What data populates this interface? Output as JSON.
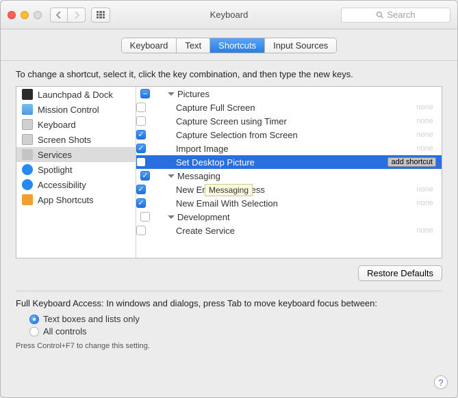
{
  "window": {
    "title": "Keyboard",
    "search_placeholder": "Search"
  },
  "tabs": [
    "Keyboard",
    "Text",
    "Shortcuts",
    "Input Sources"
  ],
  "active_tab": 2,
  "instruction": "To change a shortcut, select it, click the key combination, and then type the new keys.",
  "sidebar": {
    "items": [
      {
        "label": "Launchpad & Dock",
        "icon": "launchpad"
      },
      {
        "label": "Mission Control",
        "icon": "mission"
      },
      {
        "label": "Keyboard",
        "icon": "keyboard"
      },
      {
        "label": "Screen Shots",
        "icon": "screenshots"
      },
      {
        "label": "Services",
        "icon": "services"
      },
      {
        "label": "Spotlight",
        "icon": "spotlight"
      },
      {
        "label": "Accessibility",
        "icon": "access"
      },
      {
        "label": "App Shortcuts",
        "icon": "appshort"
      }
    ],
    "selected": 4
  },
  "shortcuts": {
    "none_label": "none",
    "add_shortcut_label": "add shortcut",
    "groups": [
      {
        "name": "Pictures",
        "state": "mixed",
        "items": [
          {
            "label": "Capture Full Screen",
            "checked": false,
            "shortcut": "none"
          },
          {
            "label": "Capture Screen using Timer",
            "checked": false,
            "shortcut": "none"
          },
          {
            "label": "Capture Selection from Screen",
            "checked": true,
            "shortcut": "none"
          },
          {
            "label": "Import Image",
            "checked": true,
            "shortcut": "none"
          },
          {
            "label": "Set Desktop Picture",
            "checked": false,
            "shortcut": "add",
            "selected": true
          }
        ]
      },
      {
        "name": "Messaging",
        "state": "checked",
        "items": [
          {
            "label": "New Email To Address",
            "checked": true,
            "shortcut": "none",
            "tooltip": "Messaging"
          },
          {
            "label": "New Email With Selection",
            "checked": true,
            "shortcut": "none"
          }
        ]
      },
      {
        "name": "Development",
        "state": "unchecked",
        "items": [
          {
            "label": "Create Service",
            "checked": false,
            "shortcut": "none"
          }
        ]
      }
    ]
  },
  "restore_label": "Restore Defaults",
  "keyboard_access": {
    "text": "Full Keyboard Access: In windows and dialogs, press Tab to move keyboard focus between:",
    "options": [
      "Text boxes and lists only",
      "All controls"
    ],
    "selected": 0,
    "footnote": "Press Control+F7 to change this setting."
  },
  "help_label": "?"
}
